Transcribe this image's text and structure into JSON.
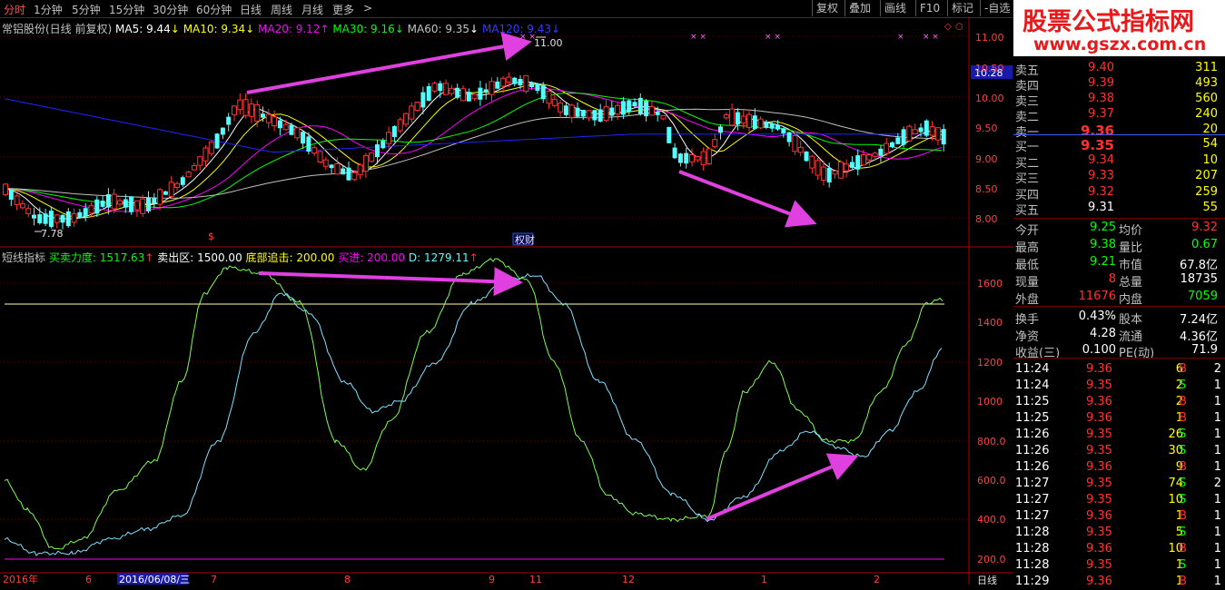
{
  "toolbar": {
    "periods": [
      "分时",
      "1分钟",
      "5分钟",
      "15分钟",
      "30分钟",
      "60分钟",
      "日线",
      "周线",
      "月线",
      "更多"
    ],
    "more_arrow": ">",
    "right_buttons": [
      "复权",
      "叠加",
      "画线",
      "F10",
      "标记",
      "-自选"
    ]
  },
  "banner": {
    "title": "股票公式指标网",
    "url": "www.gszx.com.cn"
  },
  "main_legend": {
    "name": "常铝股份(日线 前复权)",
    "ma5": "MA5: 9.44",
    "ma10": "MA10: 9.34",
    "ma20": "MA20: 9.12",
    "ma30": "MA30: 9.16",
    "ma60": "MA60: 9.35",
    "ma120": "MA120: 9.43"
  },
  "sub_legend": {
    "name": "短线指标",
    "buy_sell_power": "买卖力度: 1517.63",
    "sell_zone": "卖出区: 1500.00",
    "bottom_hit": "底部追击: 200.00",
    "buy_in": "买进: 200.00",
    "d": "D: 1279.11"
  },
  "annotations": {
    "high_label": "11.00",
    "low_label": "7.78",
    "current_price_tag": "10.28",
    "event_label": "权财",
    "bottom_dates": [
      "2016年",
      "6",
      "2016/06/08/三",
      "7",
      "8",
      "9",
      "11",
      "12",
      "1",
      "2"
    ],
    "bottom_right_label": "日线"
  },
  "colors": {
    "ma5": "#ffffff",
    "ma10": "#ffff00",
    "ma20": "#ff00ff",
    "ma30": "#00ff00",
    "ma60": "#c0c0c0",
    "ma120": "#2222ff",
    "up": "#ff3232",
    "down": "#54ffff",
    "arrow": "#e040e0"
  },
  "main_axis_ticks": [
    "11.00",
    "10.50",
    "10.00",
    "9.50",
    "9.00",
    "8.50",
    "8.00"
  ],
  "sub_axis_ticks": [
    "1600",
    "1400",
    "1200",
    "1000",
    "800.0",
    "600.0",
    "400.0",
    "200.0"
  ],
  "order_book": {
    "asks": [
      {
        "label": "卖五",
        "price": "9.40",
        "vol": "311"
      },
      {
        "label": "卖四",
        "price": "9.39",
        "vol": "493"
      },
      {
        "label": "卖三",
        "price": "9.38",
        "vol": "560"
      },
      {
        "label": "卖二",
        "price": "9.37",
        "vol": "240"
      },
      {
        "label": "卖一",
        "price": "9.36",
        "vol": "20"
      }
    ],
    "bids": [
      {
        "label": "买一",
        "price": "9.35",
        "vol": "54"
      },
      {
        "label": "买二",
        "price": "9.34",
        "vol": "10"
      },
      {
        "label": "买三",
        "price": "9.33",
        "vol": "207"
      },
      {
        "label": "买四",
        "price": "9.32",
        "vol": "259"
      },
      {
        "label": "买五",
        "price": "9.31",
        "vol": "55"
      }
    ]
  },
  "stats": [
    {
      "l1": "今开",
      "v1": "9.25",
      "l2": "均价",
      "v2": "9.32"
    },
    {
      "l1": "最高",
      "v1": "9.38",
      "l2": "量比",
      "v2": "0.67"
    },
    {
      "l1": "最低",
      "v1": "9.21",
      "l2": "市值",
      "v2": "67.8亿"
    },
    {
      "l1": "现量",
      "v1": "8",
      "l2": "总量",
      "v2": "18735"
    },
    {
      "l1": "外盘",
      "v1": "11676",
      "l2": "内盘",
      "v2": "7059"
    }
  ],
  "fundamentals": [
    {
      "l1": "换手",
      "v1": "0.43%",
      "l2": "股本",
      "v2": "7.24亿"
    },
    {
      "l1": "净资",
      "v1": "4.28",
      "l2": "流通",
      "v2": "4.36亿"
    },
    {
      "l1": "收益(三)",
      "v1": "0.100",
      "l2": "PE(动)",
      "v2": "71.9"
    }
  ],
  "trades": [
    {
      "time": "11:24",
      "price": "9.36",
      "vol": "6",
      "bs": "B",
      "n": "2"
    },
    {
      "time": "11:24",
      "price": "9.35",
      "vol": "2",
      "bs": "S",
      "n": "1"
    },
    {
      "time": "11:25",
      "price": "9.36",
      "vol": "2",
      "bs": "B",
      "n": "1"
    },
    {
      "time": "11:25",
      "price": "9.36",
      "vol": "1",
      "bs": "B",
      "n": "1"
    },
    {
      "time": "11:26",
      "price": "9.35",
      "vol": "26",
      "bs": "S",
      "n": "1"
    },
    {
      "time": "11:26",
      "price": "9.35",
      "vol": "30",
      "bs": "S",
      "n": "1"
    },
    {
      "time": "11:26",
      "price": "9.36",
      "vol": "9",
      "bs": "B",
      "n": "1"
    },
    {
      "time": "11:27",
      "price": "9.35",
      "vol": "74",
      "bs": "S",
      "n": "2"
    },
    {
      "time": "11:27",
      "price": "9.35",
      "vol": "10",
      "bs": "S",
      "n": "1"
    },
    {
      "time": "11:27",
      "price": "9.36",
      "vol": "1",
      "bs": "B",
      "n": "1"
    },
    {
      "time": "11:28",
      "price": "9.35",
      "vol": "5",
      "bs": "S",
      "n": "1"
    },
    {
      "time": "11:28",
      "price": "9.36",
      "vol": "10",
      "bs": "B",
      "n": "1"
    },
    {
      "time": "11:28",
      "price": "9.35",
      "vol": "1",
      "bs": "S",
      "n": "1"
    },
    {
      "time": "11:29",
      "price": "9.36",
      "vol": "1",
      "bs": "B",
      "n": "1"
    }
  ]
}
